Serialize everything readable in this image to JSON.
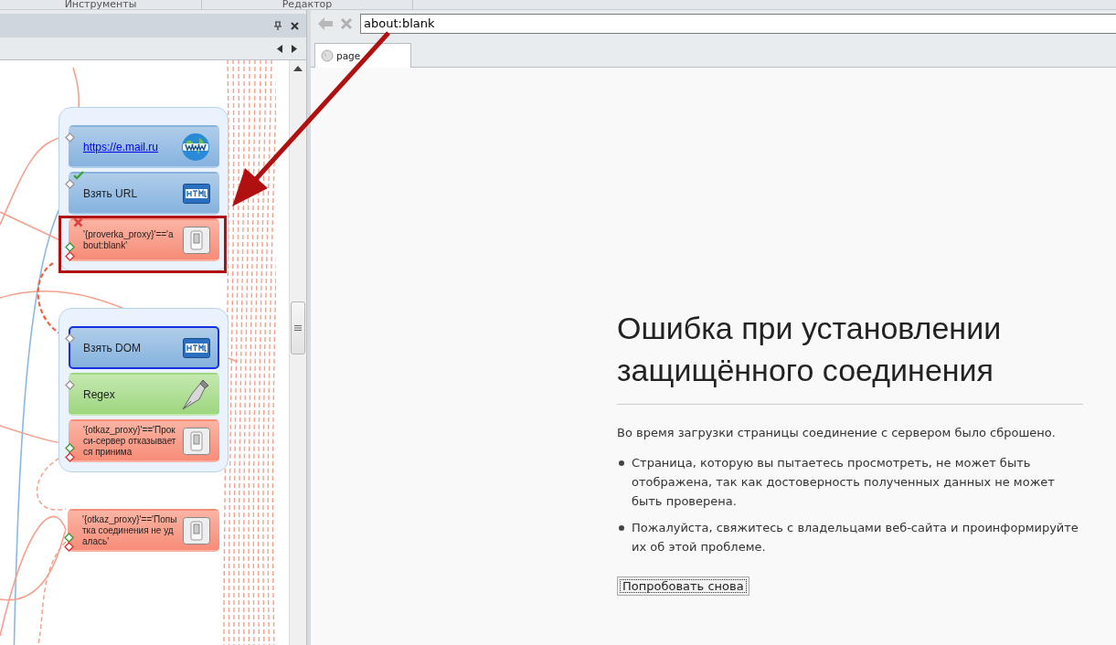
{
  "top_tabs": [
    {
      "label": "Инструменты"
    },
    {
      "label": "Редактор"
    }
  ],
  "canvas": {
    "groups": [
      {
        "nodes": [
          {
            "kind": "link",
            "text": "https://e.mail.ru",
            "passed": false,
            "failed": false,
            "selected": false
          },
          {
            "kind": "html",
            "text": "Взять URL",
            "passed": true,
            "failed": false,
            "selected": false
          },
          {
            "kind": "condition",
            "text": "'{proverka_proxy}'=='about:blank'",
            "passed": false,
            "failed": true,
            "selected": false
          }
        ]
      },
      {
        "nodes": [
          {
            "kind": "html",
            "text": "Взять DOM",
            "passed": false,
            "failed": false,
            "selected": true
          },
          {
            "kind": "regex",
            "text": "Regex",
            "passed": false,
            "failed": false,
            "selected": false
          },
          {
            "kind": "condition",
            "text": "'{otkaz_proxy}'=='Прокси-сервер отказывается принима",
            "passed": false,
            "failed": false,
            "selected": false
          }
        ]
      }
    ],
    "loose_nodes": [
      {
        "kind": "condition",
        "text": "'{otkaz_proxy}'=='Попытка соединения не удалась'",
        "passed": false,
        "failed": false,
        "selected": false
      }
    ]
  },
  "browser": {
    "address": "about:blank",
    "tabs": [
      {
        "label": "page",
        "selected": true
      }
    ],
    "error": {
      "title": "Ошибка при установлении защищённого соединения",
      "intro": "Во время загрузки страницы соединение с сервером было сброшено.",
      "bullets": [
        "Страница, которую вы пытаетесь просмотреть, не может быть отображена, так как достоверность полученных данных не может быть проверена.",
        "Пожалуйста, свяжитесь с владельцами веб-сайта и проинформируйте их об этой проблеме."
      ],
      "button": "Попробовать снова"
    }
  }
}
